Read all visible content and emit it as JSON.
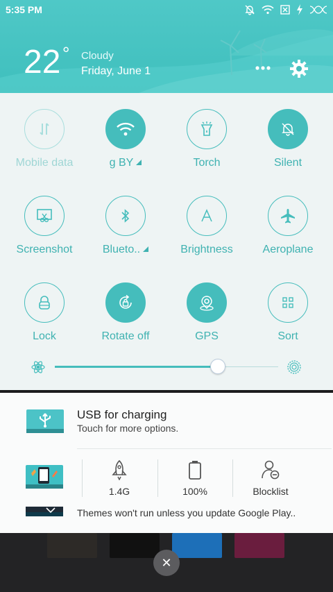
{
  "status_bar": {
    "time": "5:35 PM",
    "icons": [
      "silent-bell-icon",
      "wifi-icon",
      "no-sim-icon",
      "charging-bolt-icon",
      "dna-icon"
    ]
  },
  "weather": {
    "temperature": "22",
    "degree": "°",
    "condition": "Cloudy",
    "date": "Friday, June 1"
  },
  "quick_settings": {
    "tiles": [
      {
        "label": "Mobile data",
        "icon": "mobile-data-icon",
        "state": "unavailable"
      },
      {
        "label": "g BY",
        "icon": "wifi-icon",
        "state": "on",
        "has_menu": true
      },
      {
        "label": "Torch",
        "icon": "torch-icon",
        "state": "off"
      },
      {
        "label": "Silent",
        "icon": "silent-bell-icon",
        "state": "on"
      },
      {
        "label": "Screenshot",
        "icon": "screenshot-icon",
        "state": "off"
      },
      {
        "label": "Blueto..",
        "icon": "bluetooth-icon",
        "state": "off",
        "has_menu": true
      },
      {
        "label": "Brightness",
        "icon": "brightness-a-icon",
        "state": "off"
      },
      {
        "label": "Aeroplane",
        "icon": "aeroplane-icon",
        "state": "off"
      },
      {
        "label": "Lock",
        "icon": "lock-icon",
        "state": "off"
      },
      {
        "label": "Rotate off",
        "icon": "rotate-lock-icon",
        "state": "on"
      },
      {
        "label": "GPS",
        "icon": "gps-icon",
        "state": "on"
      },
      {
        "label": "Sort",
        "icon": "sort-grid-icon",
        "state": "off"
      }
    ],
    "brightness_level": 0.73
  },
  "notifications": {
    "usb": {
      "title": "USB for charging",
      "subtitle": "Touch for more options."
    },
    "tools": [
      {
        "label": "1.4G",
        "icon": "rocket-icon"
      },
      {
        "label": "100%",
        "icon": "battery-icon"
      },
      {
        "label": "Blocklist",
        "icon": "blocklist-user-icon"
      }
    ],
    "themes_message": "Themes won't run unless you update Google Play.."
  },
  "colors": {
    "accent": "#45bdbc",
    "header": "#4fc8c7"
  }
}
